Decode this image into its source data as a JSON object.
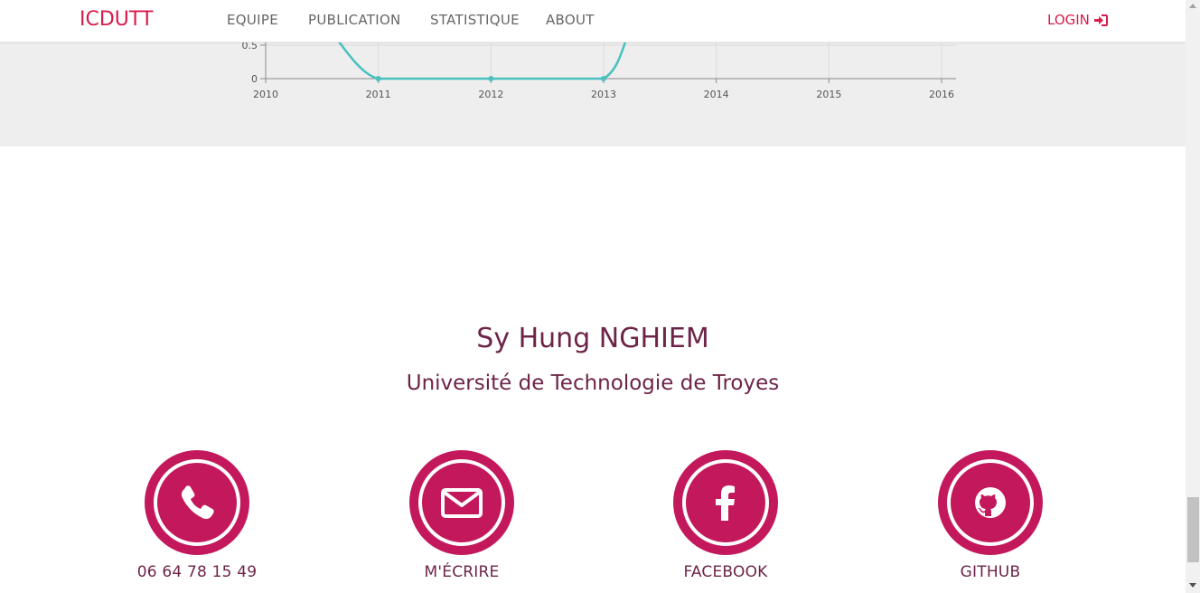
{
  "navbar": {
    "brand": "ICDUTT",
    "items": [
      {
        "label": "EQUIPE"
      },
      {
        "label": "PUBLICATION"
      },
      {
        "label": "STATISTIQUE"
      },
      {
        "label": "ABOUT"
      }
    ],
    "login_label": "LOGIN",
    "brand_color": "#d81b4a"
  },
  "chart_data": {
    "type": "line",
    "x": [
      "2010",
      "2011",
      "2012",
      "2013",
      "2014",
      "2015",
      "2016"
    ],
    "visible_y_ticks": [
      "0.5",
      "0"
    ],
    "series": [
      {
        "color": "#48c1bf",
        "points": [
          {
            "x": "2011",
            "y": 0
          },
          {
            "x": "2012",
            "y": 0
          },
          {
            "x": "2013",
            "y": 0
          }
        ]
      }
    ],
    "grid": true
  },
  "profile": {
    "name": "Sy Hung NGHIEM",
    "affiliation": "Université de Technologie de Troyes"
  },
  "contacts": [
    {
      "label": "06 64 78 15 49",
      "icon": "phone-icon"
    },
    {
      "label": "M'ÉCRIRE",
      "icon": "envelope-icon"
    },
    {
      "label": "FACEBOOK",
      "icon": "facebook-icon"
    },
    {
      "label": "GITHUB",
      "icon": "github-icon"
    }
  ],
  "colors": {
    "accent": "#c4185c",
    "text": "#6d2448",
    "line": "#48c1bf",
    "band": "#eeeeee"
  }
}
